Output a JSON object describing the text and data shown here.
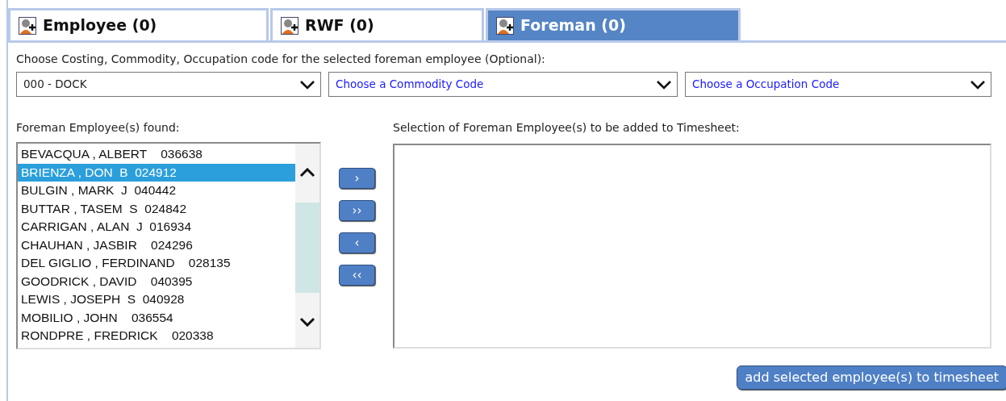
{
  "tabs": [
    {
      "label": "Employee (0)",
      "selected": false
    },
    {
      "label": "RWF (0)",
      "selected": false
    },
    {
      "label": "Foreman (0)",
      "selected": true
    }
  ],
  "codes": {
    "label": "Choose Costing, Commodity, Occupation code for the selected foreman employee (Optional):",
    "selects": [
      {
        "value": "000 - DOCK",
        "placeholder_shown": false
      },
      {
        "value": "Choose a Commodity Code",
        "placeholder_shown": true
      },
      {
        "value": "Choose a Occupation Code",
        "placeholder_shown": true
      }
    ]
  },
  "found": {
    "label": "Foreman Employee(s) found:",
    "items": [
      {
        "text": "BEVACQUA , ALBERT    036638",
        "selected": false
      },
      {
        "text": "BRIENZA , DON  B  024912",
        "selected": true
      },
      {
        "text": "BULGIN , MARK  J  040442",
        "selected": false
      },
      {
        "text": "BUTTAR , TASEM  S  024842",
        "selected": false
      },
      {
        "text": "CARRIGAN , ALAN  J  016934",
        "selected": false
      },
      {
        "text": "CHAUHAN , JASBIR    024296",
        "selected": false
      },
      {
        "text": "DEL GIGLIO , FERDINAND    028135",
        "selected": false
      },
      {
        "text": "GOODRICK , DAVID    040395",
        "selected": false
      },
      {
        "text": "LEWIS , JOSEPH  S  040928",
        "selected": false
      },
      {
        "text": "MOBILIO , JOHN    036554",
        "selected": false
      },
      {
        "text": "RONDPRE , FREDRICK    020338",
        "selected": false
      }
    ]
  },
  "move_buttons": [
    "›",
    "››",
    "‹",
    "‹‹"
  ],
  "selection": {
    "label": "Selection of Foreman Employee(s) to be added to Timesheet:"
  },
  "add_button": "add selected employee(s) to timesheet"
}
